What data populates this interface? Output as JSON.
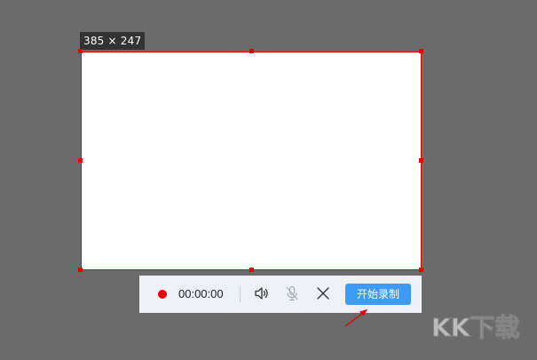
{
  "selection": {
    "size_label": "385 × 247",
    "border_color": "#e60000"
  },
  "toolbar": {
    "record_indicator_icon": "record-dot",
    "record_indicator_color": "#ee0000",
    "timer": "00:00:00",
    "speaker_icon": "speaker-icon",
    "mic_icon": "microphone-off-icon",
    "close_icon": "close-icon",
    "start_button_label": "开始录制",
    "start_button_color": "#3d9bf5"
  },
  "annotation": {
    "arrow_color": "#e60000"
  },
  "watermark": {
    "text": "KK下载"
  }
}
